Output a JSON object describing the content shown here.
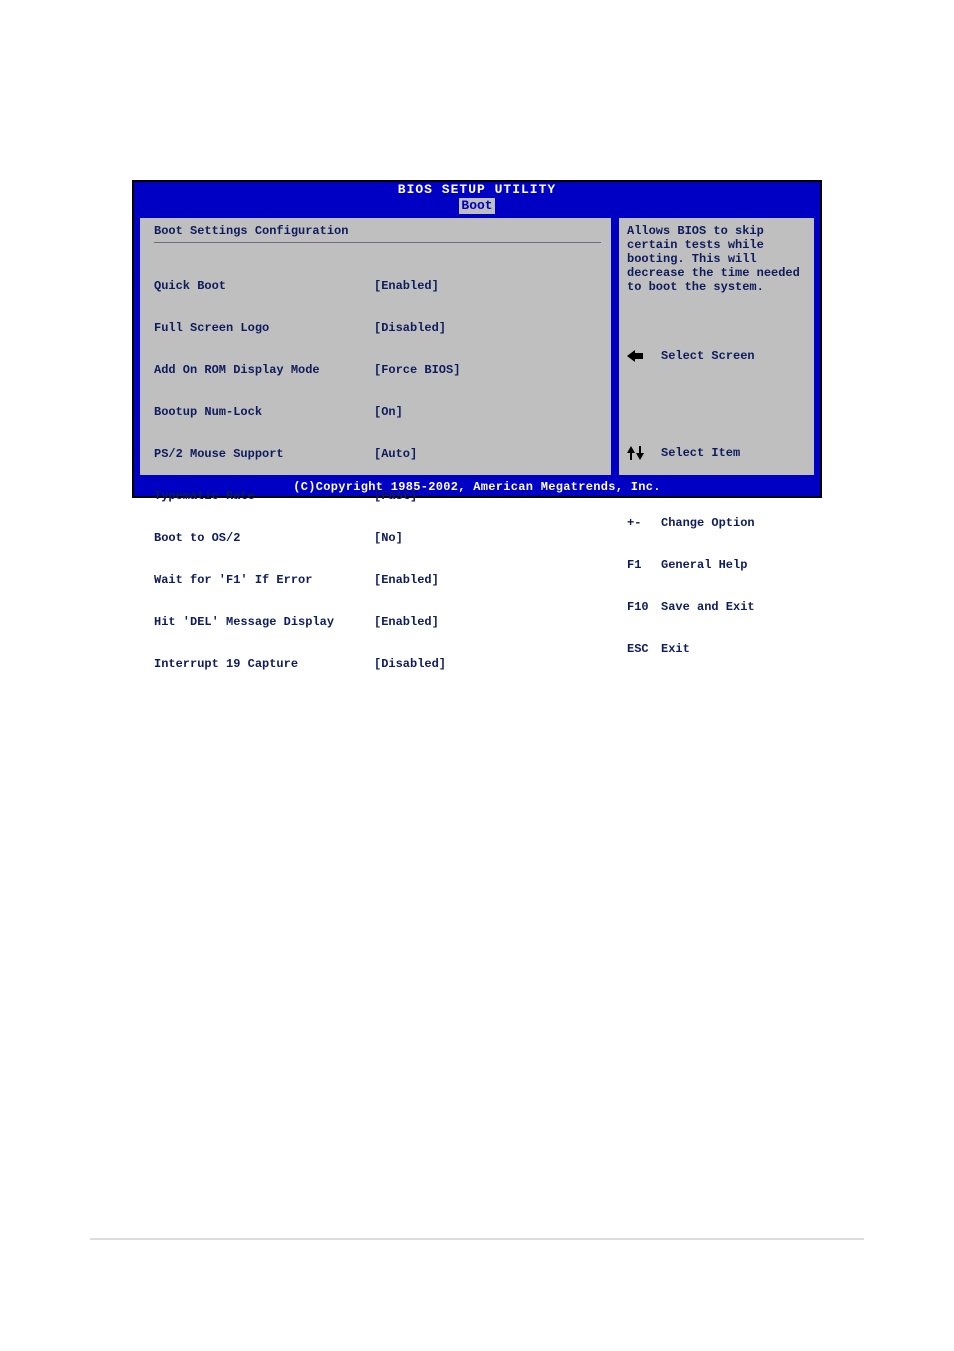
{
  "header": {
    "title": "BIOS SETUP UTILITY",
    "tab": "Boot"
  },
  "section_title": "Boot Settings Configuration",
  "settings": [
    {
      "label": "Quick Boot",
      "value": "[Enabled]"
    },
    {
      "label": "Full Screen Logo",
      "value": "[Disabled]"
    },
    {
      "label": "Add On ROM Display Mode",
      "value": "[Force BIOS]"
    },
    {
      "label": "Bootup Num-Lock",
      "value": "[On]"
    },
    {
      "label": "PS/2 Mouse Support",
      "value": "[Auto]"
    },
    {
      "label": "Typematic Rate",
      "value": "[Fast]"
    },
    {
      "label": "Boot to OS/2",
      "value": "[No]"
    },
    {
      "label": "Wait for 'F1' If Error",
      "value": "[Enabled]"
    },
    {
      "label": "Hit 'DEL' Message Display",
      "value": "[Enabled]"
    },
    {
      "label": "Interrupt 19 Capture",
      "value": "[Disabled]"
    }
  ],
  "help_text": "Allows BIOS to skip certain tests while booting. This will decrease the time needed to boot the system.",
  "legend": [
    {
      "key_icon": "arrow-left",
      "key_text": "",
      "action": "Select Screen"
    },
    {
      "key_icon": "arrows-ud",
      "key_text": "",
      "action": "Select Item"
    },
    {
      "key_icon": "",
      "key_text": "+-",
      "action": "Change Option"
    },
    {
      "key_icon": "",
      "key_text": "F1",
      "action": "General Help"
    },
    {
      "key_icon": "",
      "key_text": "F10",
      "action": "Save and Exit"
    },
    {
      "key_icon": "",
      "key_text": "ESC",
      "action": "Exit"
    }
  ],
  "footer": "(C)Copyright 1985-2002, American Megatrends, Inc."
}
